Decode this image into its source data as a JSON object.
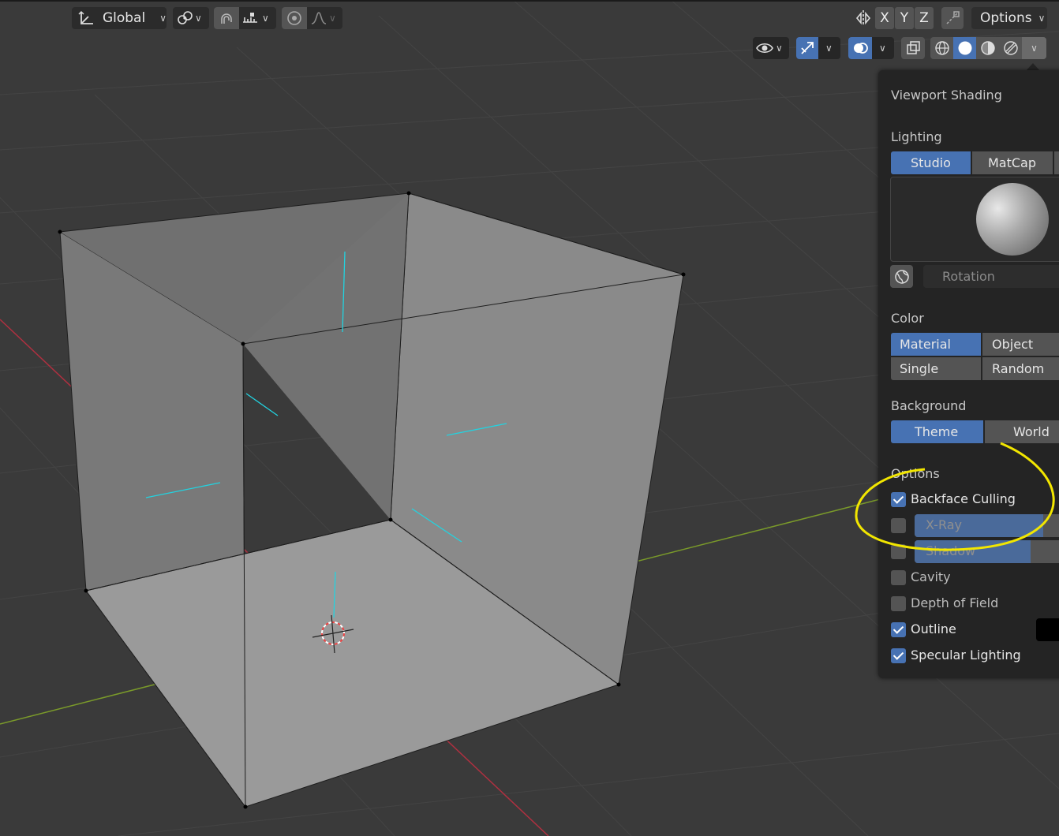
{
  "toolbar_left": {
    "orientation_label": "Global"
  },
  "toolbar_right": {
    "axis_x": "X",
    "axis_y": "Y",
    "axis_z": "Z",
    "options_label": "Options"
  },
  "panel": {
    "title": "Viewport Shading",
    "lighting": {
      "heading": "Lighting",
      "options": [
        "Studio",
        "MatCap"
      ],
      "selected": "Studio",
      "rotation_label": "Rotation"
    },
    "color": {
      "heading": "Color",
      "options": [
        "Material",
        "Object",
        "Single",
        "Random"
      ],
      "selected": "Material"
    },
    "background": {
      "heading": "Background",
      "options": [
        "Theme",
        "World"
      ],
      "selected": "Theme"
    },
    "options": {
      "heading": "Options",
      "items": [
        {
          "label": "Backface Culling",
          "checked": true
        },
        {
          "label": "X-Ray",
          "checked": false
        },
        {
          "label": "Shadow",
          "checked": false
        },
        {
          "label": "Cavity",
          "checked": false
        },
        {
          "label": "Depth of Field",
          "checked": false
        },
        {
          "label": "Outline",
          "checked": true
        },
        {
          "label": "Specular Lighting",
          "checked": true
        }
      ]
    }
  },
  "colors": {
    "viewport_bg": "#3a3a3a",
    "accent": "#4772b3",
    "highlight_annotation": "#f2e600",
    "x_axis": "#b03040",
    "y_axis": "#7a9a2a"
  }
}
